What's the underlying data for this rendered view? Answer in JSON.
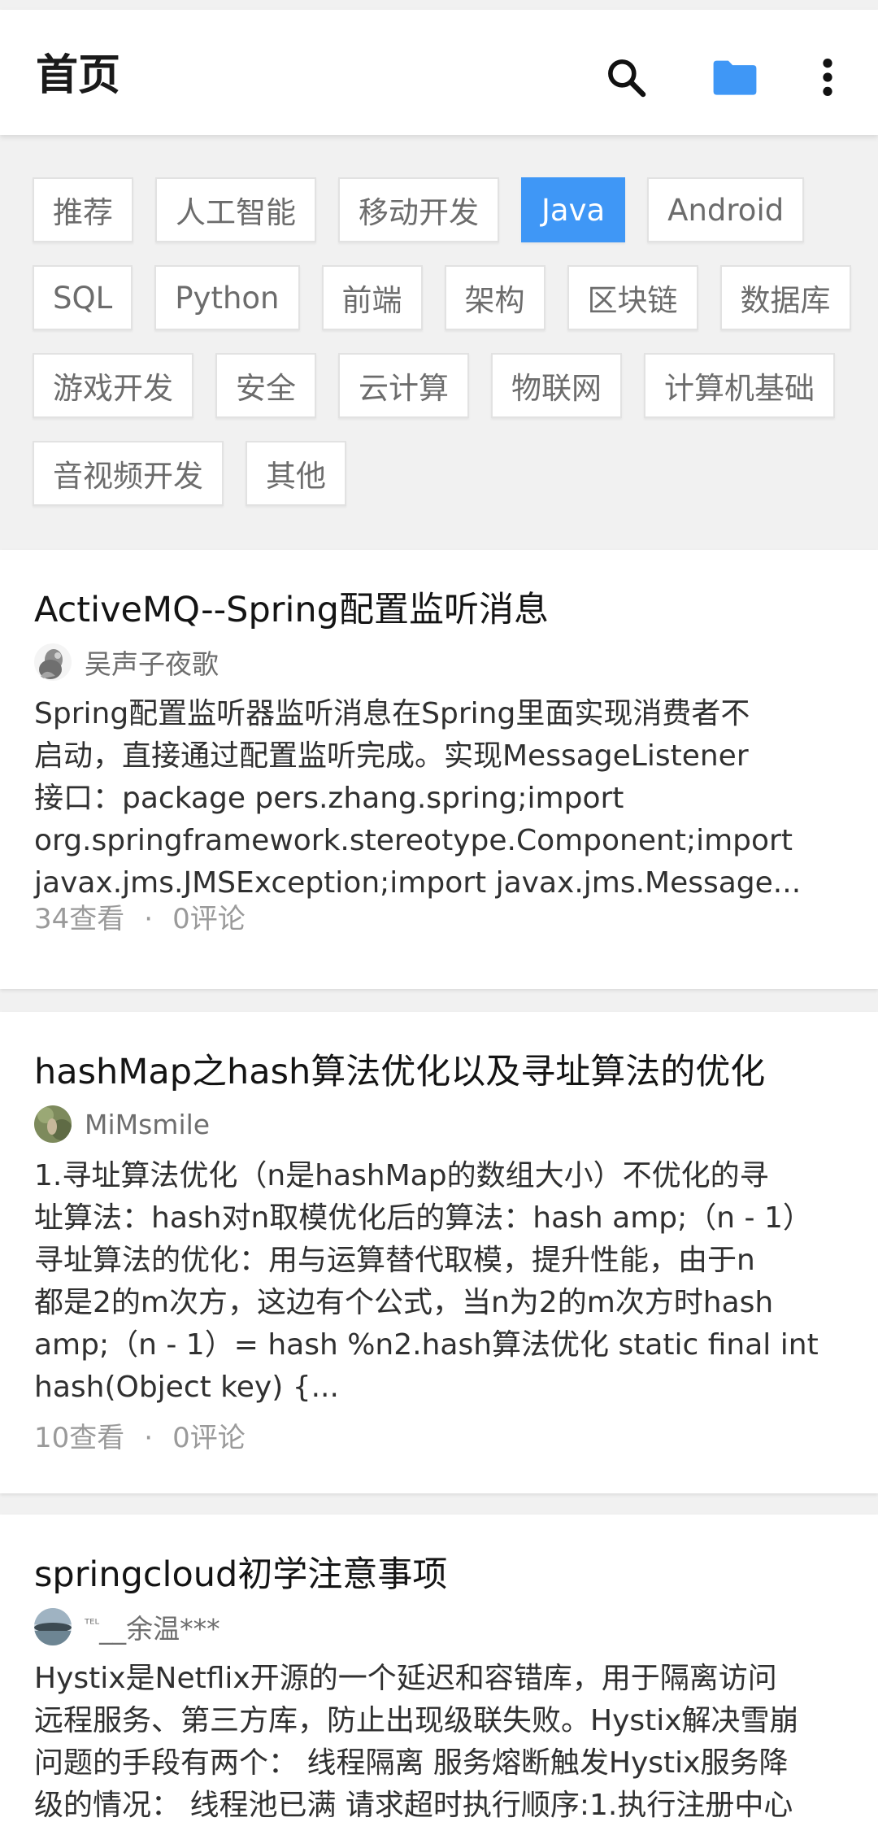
{
  "header": {
    "title": "首页",
    "icons": [
      "search-icon",
      "folder-icon",
      "more-vert-icon"
    ],
    "folder_color": "#3f97f6"
  },
  "tags": [
    {
      "label": "推荐",
      "active": false
    },
    {
      "label": "人工智能",
      "active": false
    },
    {
      "label": "移动开发",
      "active": false
    },
    {
      "label": "Java",
      "active": true
    },
    {
      "label": "Android",
      "active": false
    },
    {
      "label": "SQL",
      "active": false
    },
    {
      "label": "Python",
      "active": false
    },
    {
      "label": "前端",
      "active": false
    },
    {
      "label": "架构",
      "active": false
    },
    {
      "label": "区块链",
      "active": false
    },
    {
      "label": "数据库",
      "active": false
    },
    {
      "label": "游戏开发",
      "active": false
    },
    {
      "label": "安全",
      "active": false
    },
    {
      "label": "云计算",
      "active": false
    },
    {
      "label": "物联网",
      "active": false
    },
    {
      "label": "计算机基础",
      "active": false
    },
    {
      "label": "音视频开发",
      "active": false
    },
    {
      "label": "其他",
      "active": false
    }
  ],
  "accent_color": "#3f97f6",
  "articles": [
    {
      "title": "ActiveMQ--Spring配置监听消息",
      "author": "吴声子夜歌",
      "summary": [
        "Spring配置监听器监听消息在Spring里面实现消费者不",
        "启动，直接通过配置监听完成。实现MessageListener",
        "接口：package pers.zhang.spring;import",
        "org.springframework.stereotype.Component;import",
        "javax.jms.JMSException;import javax.jms.Message..."
      ],
      "views": "34查看",
      "separator": "·",
      "comments": "0评论"
    },
    {
      "title": "hashMap之hash算法优化以及寻址算法的优化",
      "author": "MiMsmile",
      "summary": [
        "1.寻址算法优化（n是hashMap的数组大小）不优化的寻",
        "址算法：hash对n取模优化后的算法：hash amp;（n - 1）",
        "寻址算法的优化：用与运算替代取模，提升性能，由于n",
        "都是2的m次方，这边有个公式，当n为2的m次方时hash",
        "amp;（n - 1）= hash %n2.hash算法优化   static final int",
        "hash(Object key) {..."
      ],
      "views": "10查看",
      "separator": "·",
      "comments": "0评论"
    },
    {
      "title": "springcloud初学注意事项",
      "author_prefix": "ᵀᴱᴸ",
      "author": "__余温***",
      "summary": [
        "Hystix是Netflix开源的一个延迟和容错库，用于隔离访问",
        "远程服务、第三方库，防止出现级联失败。Hystix解决雪崩",
        "问题的手段有两个：  线程隔离 服务熔断触发Hystix服务降",
        "级的情况：  线程池已满 请求超时执行顺序:1.执行注册中心"
      ]
    }
  ]
}
